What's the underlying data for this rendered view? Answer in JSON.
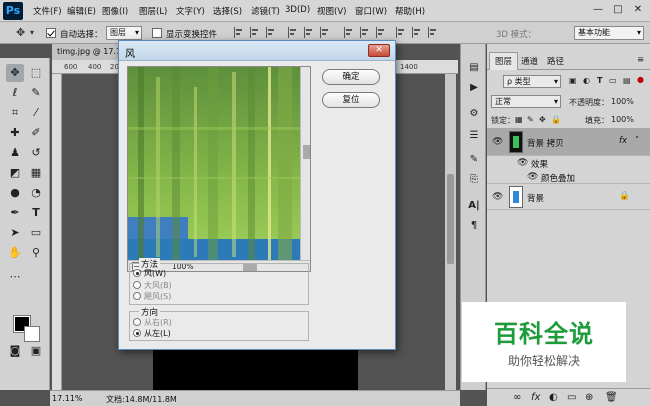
{
  "app": {
    "logo": "Ps"
  },
  "menu": [
    "文件(F)",
    "编辑(E)",
    "图像(I)",
    "图层(L)",
    "文字(Y)",
    "选择(S)",
    "滤镜(T)",
    "3D(D)",
    "视图(V)",
    "窗口(W)",
    "帮助(H)"
  ],
  "window_controls": {
    "minimize": "—",
    "maximize": "□",
    "close": "✕"
  },
  "options": {
    "auto_select_label": "自动选择：",
    "auto_select_value": "图层",
    "show_transform_label": "显示变换控件",
    "mode_3d_label": "3D 模式：",
    "workspace": "基本功能"
  },
  "document": {
    "tab_title": "timg.jpg @ 17.1",
    "ruler_marks": [
      "600",
      "400",
      "200"
    ],
    "ruler_mark_right": "1400",
    "zoom": "17.11%",
    "doc_info": "文档:14.8M/11.8M"
  },
  "dialog": {
    "title": "风",
    "close": "✕",
    "ok": "确定",
    "reset": "复位",
    "preview_zoom": "100%",
    "zoom_minus": "−",
    "zoom_plus": "+",
    "method_title": "方法",
    "method_options": [
      "风(W)",
      "大风(B)",
      "飓风(S)"
    ],
    "direction_title": "方向",
    "direction_options": [
      "从右(R)",
      "从左(L)"
    ]
  },
  "layers": {
    "tabs": [
      "图层",
      "通道",
      "路径"
    ],
    "kind_label": "ρ 类型",
    "blend_mode": "正常",
    "opacity_label": "不透明度：",
    "opacity_value": "100%",
    "lock_label": "锁定：",
    "fill_label": "填充：",
    "fill_value": "100%",
    "rows": [
      {
        "name": "背景 拷贝",
        "fx": "fx"
      },
      {
        "name": "效果"
      },
      {
        "name": "颜色叠加"
      },
      {
        "name": "背景"
      }
    ],
    "bottom_icons": [
      "∞",
      "fx",
      "◐",
      "▭",
      "⊕",
      "🗑"
    ]
  },
  "watermark": {
    "big": "百科全说",
    "small": "助你轻松解决"
  }
}
